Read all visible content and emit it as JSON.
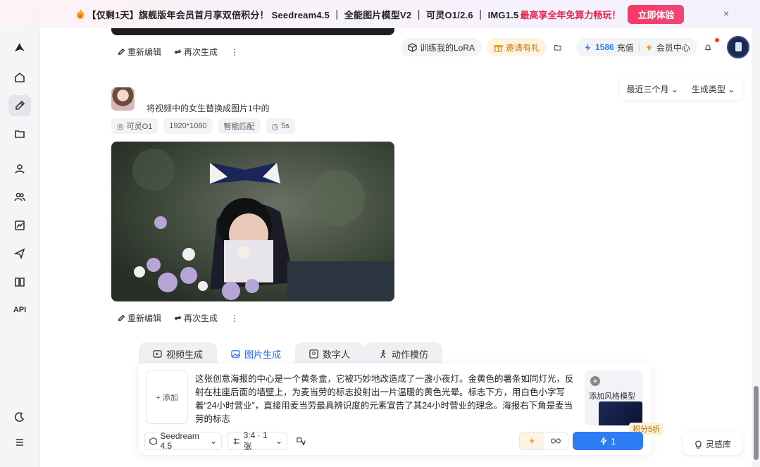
{
  "banner": {
    "text": "【仅剩1天】旗舰版年会员首月享双倍积分！ Seedream4.5 ｜ 全能图片模型V2 ｜ 可灵O1/2.6 ｜ IMG1.5",
    "hot_text": "最高享全年免算力畅玩！",
    "cta_label": "立即体验",
    "close_label": "×"
  },
  "sidebar": {
    "api_label": "API"
  },
  "header": {
    "train_lora": "训练我的LoRA",
    "invite": "邀请有礼",
    "points": "1586",
    "recharge": "充值",
    "member_center": "会员中心"
  },
  "filters": {
    "time": "最近三个月",
    "type": "生成类型"
  },
  "feed": {
    "edit_label": "重新编辑",
    "regen_label": "再次生成",
    "more_label": "⋮",
    "prompt": "将视频中的女生替换成图片1中的",
    "tags": [
      "可灵O1",
      "1920*1080",
      "智能匹配",
      "5s"
    ]
  },
  "composer": {
    "tabs": [
      {
        "label": "视频生成"
      },
      {
        "label": "图片生成"
      },
      {
        "label": "数字人"
      },
      {
        "label": "动作模仿"
      }
    ],
    "add_label": "+ 添加",
    "prompt_text": "这张创意海报的中心是一个黄条盒，它被巧妙地改造成了一盏小夜灯。金黄色的薯条如同灯光，反射在柱座后面的墙壁上，为麦当劳的标志投射出一片温暖的黄色光晕。标志下方，用白色小字写着“24小时营业”，直接用麦当劳最具辨识度的元素宣告了其24小时营业的理念。海报右下角是麦当劳的标志",
    "style_card_label": "添加风格模型",
    "points_badge": "积分5折",
    "model": "Seedream 4.5",
    "ratio": "3:4 · 1张",
    "generate_count": "1",
    "inspiration": "灵感库"
  }
}
